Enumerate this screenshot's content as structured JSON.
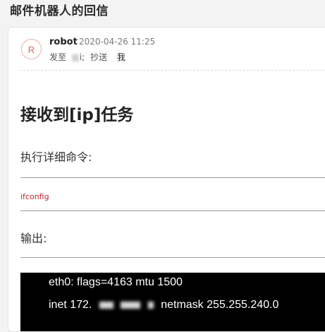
{
  "page": {
    "title": "邮件机器人的回信"
  },
  "mail": {
    "avatar_letter": "R",
    "sender": "robot",
    "timestamp": "2020-04-26 11:25",
    "to_label": "发至",
    "to_value": "i;",
    "cc_label": "抄送",
    "cc_value": "我"
  },
  "body": {
    "heading": "接收到[ip]任务",
    "command_label": "执行详细命令:",
    "command": "ifconfig",
    "output_label": "输出:",
    "output_lines": [
      "eth0: flags=4163 mtu 1500",
      "inet 172.",
      "netmask 255.255.240.0"
    ]
  }
}
